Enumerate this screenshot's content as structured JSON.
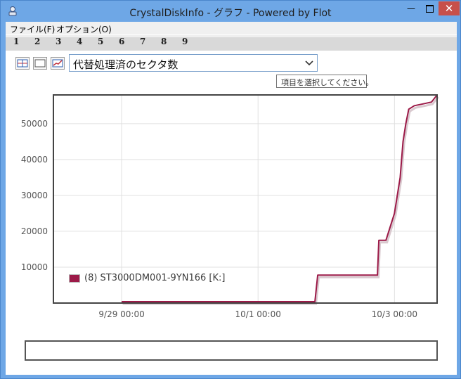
{
  "window": {
    "title": "CrystalDiskInfo - グラフ - Powered by Flot",
    "min_glyph": "—",
    "close_glyph": "✕"
  },
  "menu": {
    "file": "ファイル(F)",
    "options": "オプション(O)"
  },
  "disk_tabs": [
    "1",
    "2",
    "3",
    "4",
    "5",
    "6",
    "7",
    "8",
    "9"
  ],
  "toolbar": {
    "selected_attribute": "代替処理済のセクタ数",
    "tooltip": "項目を選択してください。"
  },
  "colors": {
    "series": "#9c1a48",
    "series_shadow": "#d9c9cf",
    "grid": "#e0e0e0",
    "frame": "#444444",
    "tick_label": "#545454"
  },
  "chart_data": {
    "type": "line",
    "x_axis": "time",
    "xlim": [
      "2012-09-28 00:00",
      "2012-10-03 15:00"
    ],
    "ylim": [
      0,
      58000
    ],
    "x_ticks": [
      "9/29 00:00",
      "10/1 00:00",
      "10/3 00:00"
    ],
    "y_ticks": [
      "10000",
      "20000",
      "30000",
      "40000",
      "50000"
    ],
    "grid": true,
    "legend_position": "bottom-left",
    "series": [
      {
        "name": "(8) ST3000DM001-9YN166 [K:]",
        "points": [
          [
            "2012-09-29 00:00",
            400
          ],
          [
            "2012-10-01 20:00",
            400
          ],
          [
            "2012-10-01 21:00",
            7800
          ],
          [
            "2012-10-02 18:00",
            7800
          ],
          [
            "2012-10-02 18:30",
            17500
          ],
          [
            "2012-10-02 21:00",
            17500
          ],
          [
            "2012-10-03 00:00",
            25000
          ],
          [
            "2012-10-03 02:00",
            35000
          ],
          [
            "2012-10-03 03:00",
            45000
          ],
          [
            "2012-10-03 04:00",
            50000
          ],
          [
            "2012-10-03 05:00",
            54000
          ],
          [
            "2012-10-03 07:00",
            55000
          ],
          [
            "2012-10-03 10:00",
            55500
          ],
          [
            "2012-10-03 13:00",
            56000
          ],
          [
            "2012-10-03 14:00",
            57000
          ],
          [
            "2012-10-03 15:00",
            58000
          ]
        ]
      }
    ]
  }
}
